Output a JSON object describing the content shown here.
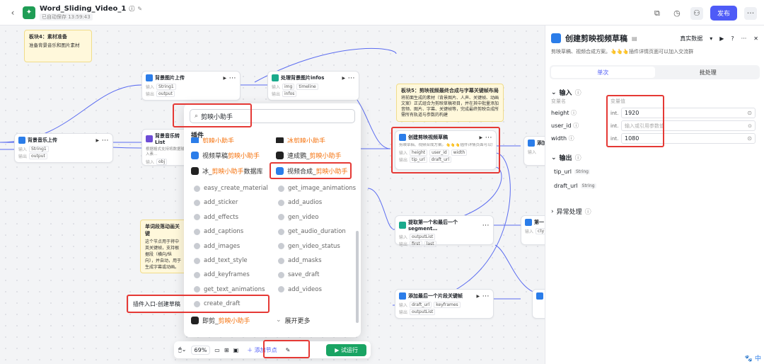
{
  "topbar": {
    "title": "Word_Sliding_Video_1",
    "saved": "已自动保存 13:59:43",
    "publish": "发布",
    "more": "···"
  },
  "canvas": {
    "notes": [
      {
        "title": "板块4：素材准备",
        "text": "准备背景音乐和图片素材"
      },
      {
        "title": "板块5：剪映视频最终合成与字幕关键帧布局",
        "text": "将前面生成的素材（背景图片、人声、关键帧、动画文案）正式组合为剪映草稿项目，并在其中批量添加音频、图片、字幕、关键帧等，完成最终剪映合成所需所有轨道与参数的构建"
      },
      {
        "title": "单词段落动画关键",
        "text": "这个节点用于将中英关键帧，支持根据段（横向/纵向），并自动，用于生成字幕或动画。"
      }
    ],
    "nodes": {
      "bgimg": {
        "title": "背景图片上传",
        "in_label": "输入",
        "in_val": "String1",
        "out_label": "输出",
        "out_val": "output"
      },
      "procimg": {
        "title": "处理背景图片infos",
        "in_label": "输入",
        "in_a": "img",
        "in_b": "timeline",
        "out_label": "输出",
        "out_val": "infos"
      },
      "bgmusic": {
        "title": "背景音乐上传",
        "in_label": "输入",
        "in_val": "String1",
        "out_label": "输出",
        "out_val": "output"
      },
      "musiclist": {
        "title": "背景音乐转List",
        "desc": "根据格式支持将数据输入素…",
        "in_label": "输入",
        "in_val": "obj",
        "out_label": "输出",
        "out_val": "infos"
      },
      "create": {
        "title": "创建剪映视频草稿",
        "desc": "剪映草稿、视频合成方案。👆👆👆插件详情页面可以加入交…",
        "in_label": "输入",
        "in_a": "height",
        "in_b": "user_id",
        "in_c": "width",
        "out_label": "输出",
        "out_a": "tip_url",
        "out_b": "draft_url"
      },
      "first": {
        "title": "提取第一个和最后一个segment…",
        "in_label": "输入",
        "in_val": "outputList",
        "out_label": "输出",
        "out_a": "first",
        "out_b": "last"
      },
      "keyframe": {
        "title": "添加最后一个片段关键帧",
        "in_label": "输入",
        "in_a": "draft_url",
        "in_b": "keyframes",
        "out_label": "输出",
        "out_val": "outputList"
      },
      "addx": {
        "title": "添加",
        "in_label": "输入"
      },
      "firstr": {
        "title": "第一",
        "in_label": "输入",
        "in_val": "cty"
      },
      "addr2": {
        "title": "添"
      }
    },
    "plugin_entry_label": "插件入口-创建草稿"
  },
  "popup": {
    "search_value": "剪映小助手",
    "section_title": "插件",
    "items": [
      {
        "pre": "",
        "text": "剪映小助手",
        "pre2": "",
        "text2": "冰剪映小助手"
      },
      {
        "pre": "视频草稿",
        "hi": "剪映小助手",
        "pre2": "速成鹦_",
        "hi2": "剪映小助手"
      },
      {
        "pre": "冰_",
        "hi": "剪映小助手",
        "post": "数据库",
        "pre2": "视频合成_",
        "hi2": "剪映小助手"
      }
    ],
    "funcs_left": [
      "easy_create_material",
      "add_sticker",
      "add_effects",
      "add_captions",
      "add_images",
      "add_text_style",
      "add_keyframes",
      "get_text_animations",
      "create_draft"
    ],
    "funcs_right": [
      "get_image_animations",
      "add_audios",
      "gen_video",
      "get_audio_duration",
      "gen_video_status",
      "add_masks",
      "save_draft",
      "add_videos"
    ],
    "bottom_left_pre": "即剪_",
    "bottom_left_hi": "剪映小助手",
    "bottom_right": "展开更多"
  },
  "toolbar": {
    "zoom": "69%",
    "add_node": "添加节点",
    "run": "试运行"
  },
  "panel": {
    "title": "创建剪映视频草稿",
    "mode": "真实数据",
    "desc": "剪映草稿、视频合成方案。👆👆👆插件详情页面可以加入交流群",
    "tab_single": "单次",
    "tab_batch": "批处理",
    "input_title": "输入",
    "col_name": "变量名",
    "col_value": "变量值",
    "params": [
      {
        "name": "height",
        "type": "int.",
        "value": "1920",
        "placeholder": ""
      },
      {
        "name": "user_id",
        "type": "int.",
        "value": "",
        "placeholder": "输入或引用参数值"
      },
      {
        "name": "width",
        "type": "int.",
        "value": "1080",
        "placeholder": ""
      }
    ],
    "output_title": "输出",
    "outputs": [
      {
        "name": "tip_url",
        "type": "String"
      },
      {
        "name": "draft_url",
        "type": "String"
      }
    ],
    "error_title": "异常处理"
  },
  "colors": {
    "primary": "#4e5bf7",
    "run": "#19a463",
    "highlight": "#e53935",
    "orange": "#f5700a"
  }
}
